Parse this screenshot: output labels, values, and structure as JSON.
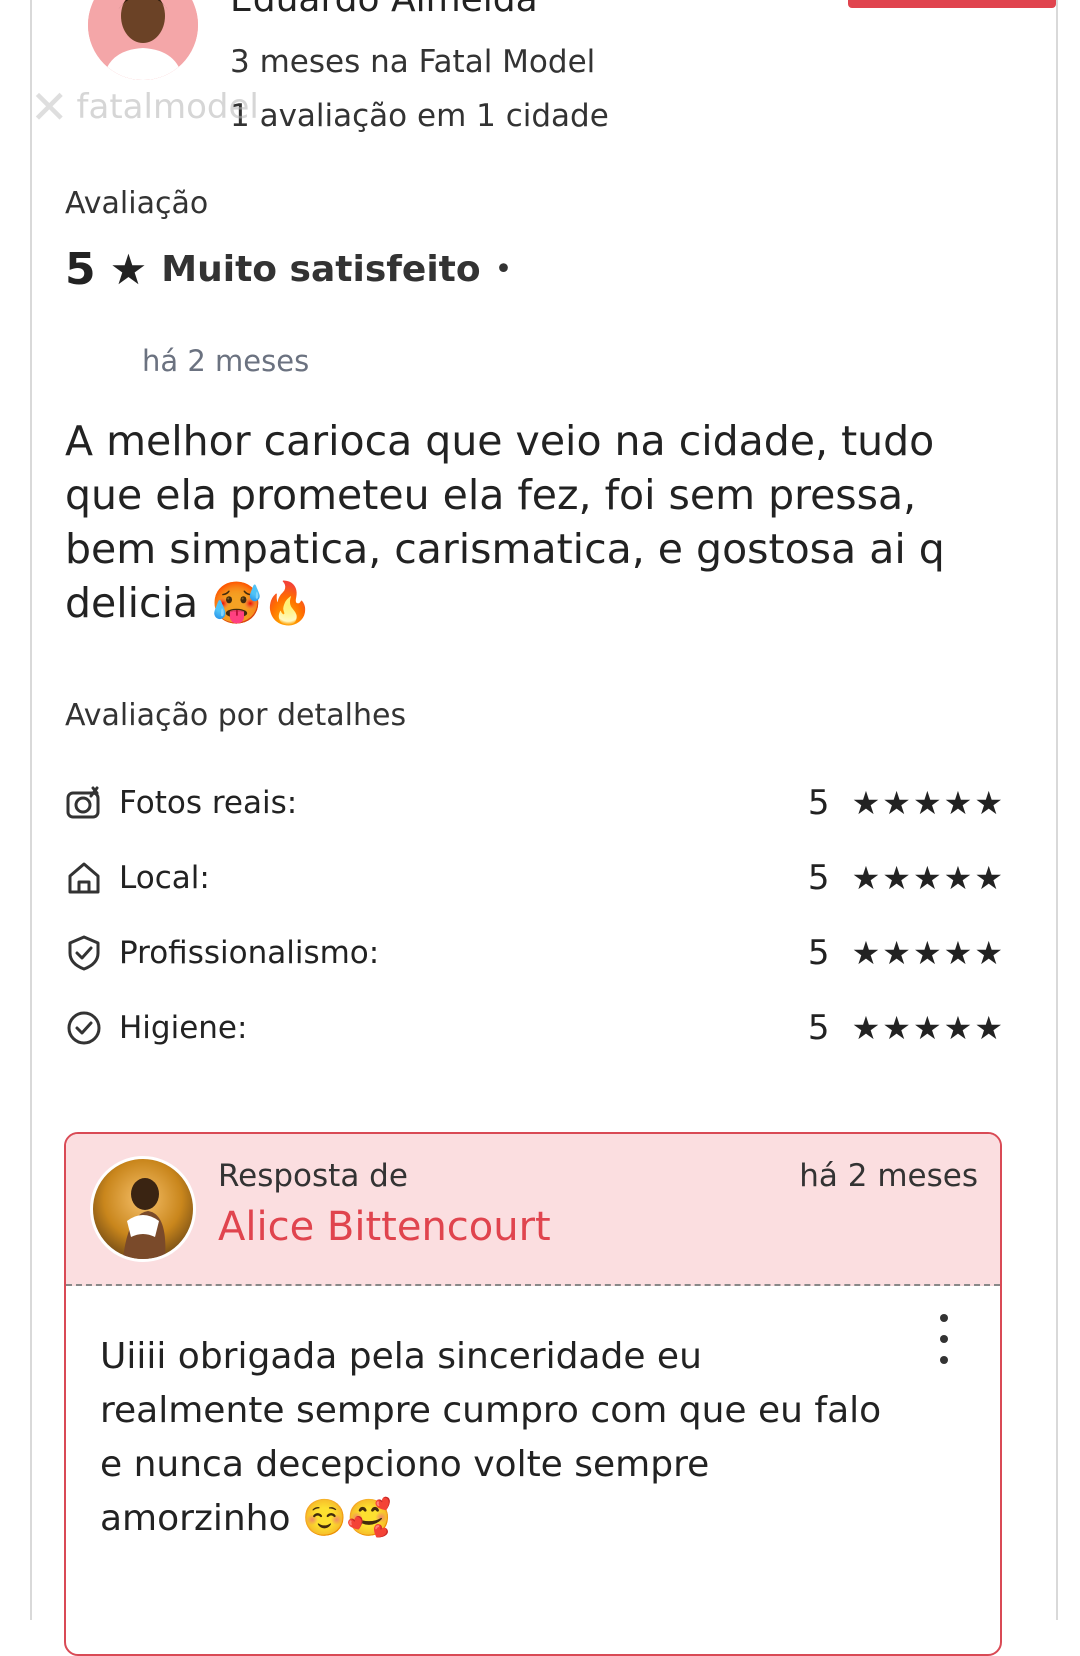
{
  "reviewer": {
    "name": "Eduardo Almeida",
    "tenure": "3 meses na Fatal Model",
    "reviews_count": "1 avaliação em 1 cidade"
  },
  "watermark": "fatalmodel",
  "rating": {
    "label": "Avaliação",
    "score": "5",
    "star": "★",
    "sentiment": "Muito satisfeito",
    "separator": "•",
    "time_ago": "há 2 meses"
  },
  "review": {
    "text": "A melhor carioca que veio na cidade, tudo que ela prometeu ela fez, foi sem pressa, bem simpatica, carismatica, e gostosa ai q delicia 🥵🔥"
  },
  "details": {
    "title": "Avaliação por detalhes",
    "items": [
      {
        "label": "Fotos reais:",
        "score": "5",
        "stars": "★★★★★",
        "icon": "camera-icon"
      },
      {
        "label": "Local:",
        "score": "5",
        "stars": "★★★★★",
        "icon": "home-icon"
      },
      {
        "label": "Profissionalismo:",
        "score": "5",
        "stars": "★★★★★",
        "icon": "shield-check-icon"
      },
      {
        "label": "Higiene:",
        "score": "5",
        "stars": "★★★★★",
        "icon": "check-circle-icon"
      }
    ]
  },
  "reply": {
    "from_label": "Resposta de",
    "author": "Alice Bittencourt",
    "time_ago": "há 2 meses",
    "text": "Uiiii obrigada pela sinceridade eu realmente sempre cumpro com que eu falo e nunca decepciono volte sempre amorzinho ☺️🥰"
  },
  "colors": {
    "accent": "#e0444e",
    "reply_bg": "#fbdee0",
    "muted": "#6b7280"
  }
}
